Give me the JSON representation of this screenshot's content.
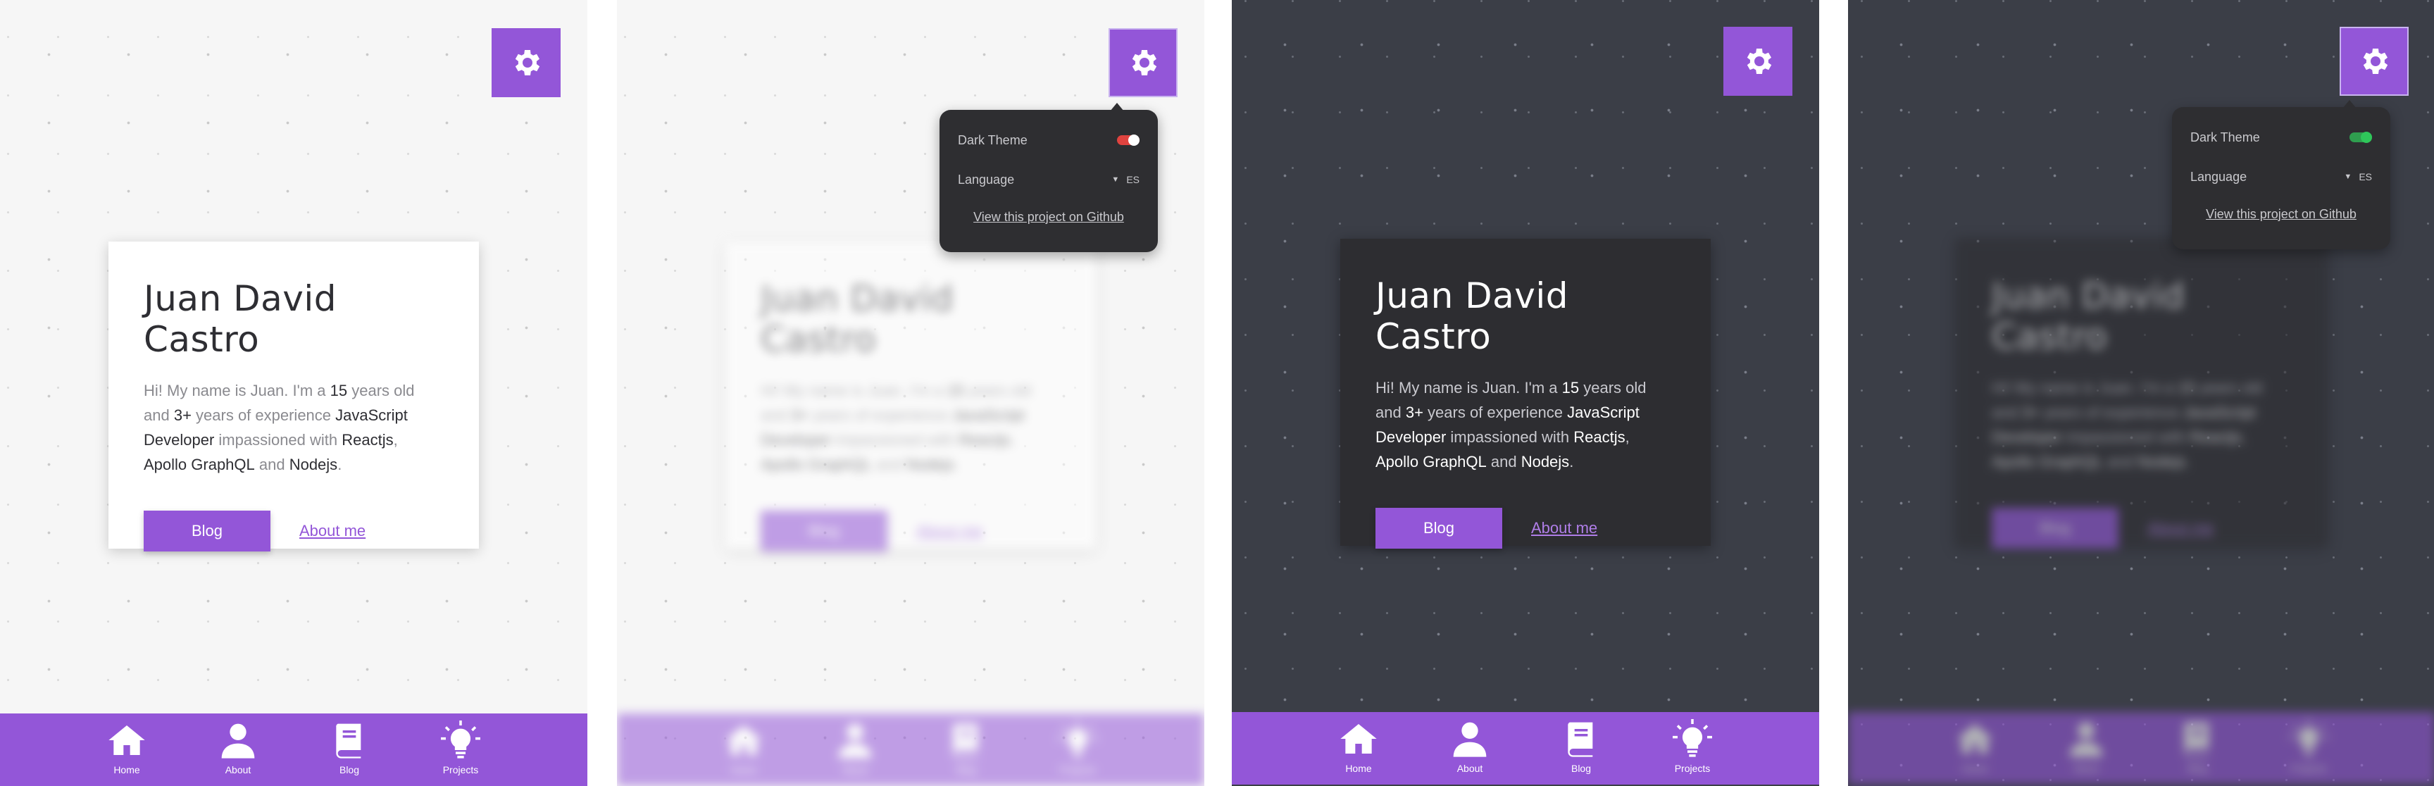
{
  "profile": {
    "name": "Juan David Castro",
    "intro_parts": [
      {
        "t": "Hi! My name is Juan. I'm a ",
        "b": false
      },
      {
        "t": "15",
        "b": true
      },
      {
        "t": " years old and ",
        "b": false
      },
      {
        "t": "3+",
        "b": true
      },
      {
        "t": " years of experience ",
        "b": false
      },
      {
        "t": "JavaScript Developer",
        "b": true
      },
      {
        "t": " impassioned with ",
        "b": false
      },
      {
        "t": "Reactjs",
        "b": true
      },
      {
        "t": ", ",
        "b": false
      },
      {
        "t": "Apollo GraphQL",
        "b": true
      },
      {
        "t": " and ",
        "b": false
      },
      {
        "t": "Nodejs",
        "b": true
      },
      {
        "t": ".",
        "b": false
      }
    ],
    "blog_button": "Blog",
    "about_link": "About me"
  },
  "settings": {
    "dark_theme_label": "Dark Theme",
    "language_label": "Language",
    "language_value": "ES",
    "github_link": "View this project on Github"
  },
  "nav": [
    {
      "label": "Home",
      "icon": "home-icon"
    },
    {
      "label": "About",
      "icon": "user-icon"
    },
    {
      "label": "Blog",
      "icon": "book-icon"
    },
    {
      "label": "Projects",
      "icon": "lightbulb-icon"
    }
  ],
  "colors": {
    "accent": "#9356d8",
    "light_bg": "#f6f6f6",
    "dark_bg": "#3b3e47",
    "card_dark": "#2d2d31",
    "menu_bg": "#2e2e31",
    "toggle_off": "#e0433f",
    "toggle_on": "#2fc75a"
  }
}
